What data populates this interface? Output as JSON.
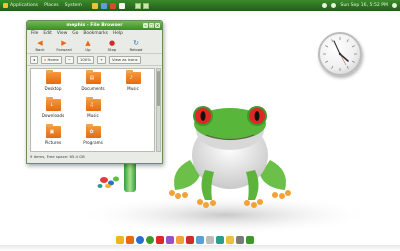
{
  "top_panel": {
    "applications": "Applications",
    "places": "Places",
    "system": "System",
    "clock_text": "Sun Sep 16, 5:52 PM",
    "colors": {
      "panel": "#2f7a22",
      "launcher_a": "#e9c23a",
      "launcher_b": "#5aa0d8",
      "launcher_c": "#d94a2a"
    }
  },
  "window": {
    "title": "mephis - File Browser",
    "menu": [
      "File",
      "Edit",
      "View",
      "Go",
      "Bookmarks",
      "Help"
    ],
    "toolbar": [
      {
        "label": "Back",
        "icon": "back-arrow-icon"
      },
      {
        "label": "Forward",
        "icon": "forward-arrow-icon"
      },
      {
        "label": "Up",
        "icon": "up-arrow-icon"
      },
      {
        "label": "Stop",
        "icon": "stop-icon"
      },
      {
        "label": "Reload",
        "icon": "reload-icon"
      }
    ],
    "location": {
      "home_label": "Home",
      "view_label": "View as Icons",
      "zoom": "100%"
    },
    "items": [
      {
        "label": "Desktop",
        "icon": "folder-icon"
      },
      {
        "label": "Documents",
        "icon": "folder-icon"
      },
      {
        "label": "Music",
        "icon": "folder-icon"
      },
      {
        "label": "Downloads",
        "icon": "folder-icon"
      },
      {
        "label": "Music",
        "icon": "folder-icon"
      },
      {
        "label": "Pictures",
        "icon": "folder-icon"
      },
      {
        "label": "Programs",
        "icon": "folder-icon"
      }
    ],
    "status": "9 items, Free space: 65.4 GB"
  }
}
